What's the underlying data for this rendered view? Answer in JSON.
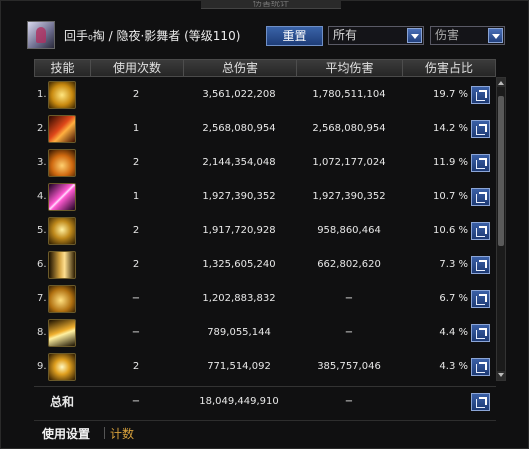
{
  "window": {
    "title": "伤害统计"
  },
  "header": {
    "character": "回手₀掏 / 隐夜·影舞者 (等级110)",
    "reset_label": "重置",
    "filter_value": "所有",
    "type_value": "伤害"
  },
  "table": {
    "columns": [
      "技能",
      "使用次数",
      "总伤害",
      "平均伤害",
      "伤害占比"
    ],
    "rows": [
      {
        "idx": "1.",
        "icon": "golden-swirl-skill-icon",
        "count": "2",
        "total": "3,561,022,208",
        "avg": "1,780,511,104",
        "pct": "19.7 %"
      },
      {
        "idx": "2.",
        "icon": "red-slash-skill-icon",
        "count": "1",
        "total": "2,568,080,954",
        "avg": "2,568,080,954",
        "pct": "14.2 %"
      },
      {
        "idx": "3.",
        "icon": "flame-burst-skill-icon",
        "count": "2",
        "total": "2,144,354,048",
        "avg": "1,072,177,024",
        "pct": "11.9 %"
      },
      {
        "idx": "4.",
        "icon": "cross-blade-skill-icon",
        "count": "1",
        "total": "1,927,390,352",
        "avg": "1,927,390,352",
        "pct": "10.7 %"
      },
      {
        "idx": "5.",
        "icon": "shadow-mask-skill-icon",
        "count": "2",
        "total": "1,917,720,928",
        "avg": "958,860,464",
        "pct": "10.6 %"
      },
      {
        "idx": "6.",
        "icon": "dash-strike-skill-icon",
        "count": "2",
        "total": "1,325,605,240",
        "avg": "662,802,620",
        "pct": "7.3 %"
      },
      {
        "idx": "7.",
        "icon": "fighter-stance-skill-icon",
        "count": "−",
        "total": "1,202,883,832",
        "avg": "−",
        "pct": "6.7 %"
      },
      {
        "idx": "8.",
        "icon": "arrow-dash-skill-icon",
        "count": "−",
        "total": "789,055,144",
        "avg": "−",
        "pct": "4.4 %"
      },
      {
        "idx": "9.",
        "icon": "star-burst-skill-icon",
        "count": "2",
        "total": "771,514,092",
        "avg": "385,757,046",
        "pct": "4.3 %"
      }
    ]
  },
  "total": {
    "label": "总和",
    "count": "−",
    "total": "18,049,449,910",
    "avg": "−"
  },
  "tabs": {
    "settings": "使用设置",
    "count": "计数"
  },
  "colors": {
    "accent_blue": "#2e5296",
    "tab_gold": "#d9a23c",
    "background": "#101011"
  }
}
